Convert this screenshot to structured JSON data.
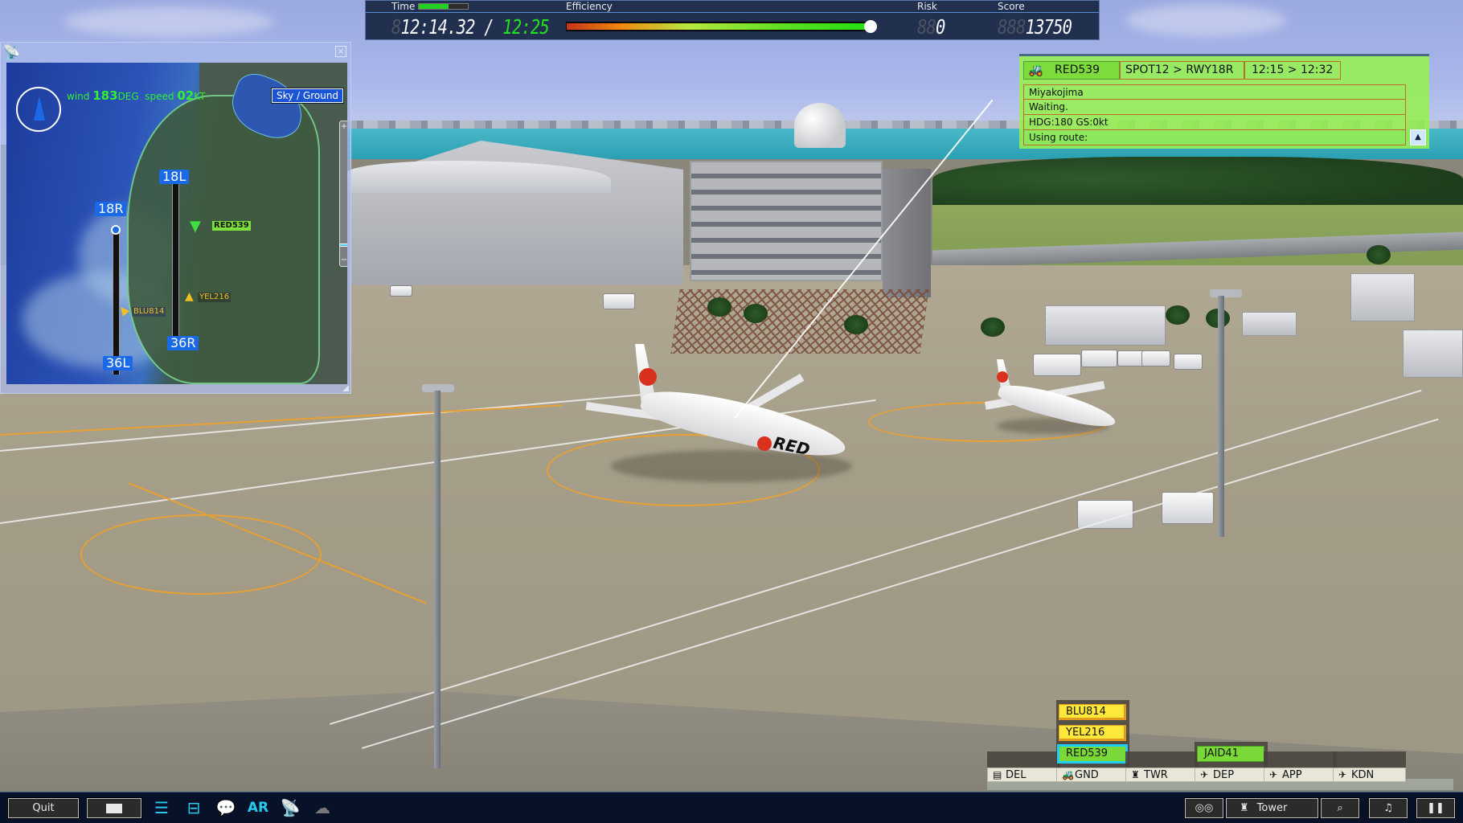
{
  "hud": {
    "time_label": "Time",
    "time_progress": 0.6,
    "efficiency_label": "Efficiency",
    "efficiency_value": 1.0,
    "risk_label": "Risk",
    "score_label": "Score",
    "clock_ghost": "8",
    "clock_current": "12:14.32",
    "clock_sep": "/",
    "clock_end": "12:25",
    "risk_ghost": "88",
    "risk_value": "0",
    "score_ghost": "888",
    "score_value": "13750"
  },
  "minimap": {
    "close_icon": "close-icon",
    "wind_prefix": "wind",
    "wind_deg": "183",
    "wind_deg_unit": "DEG",
    "speed_prefix": "speed",
    "wind_speed": "02",
    "wind_speed_unit": "KT",
    "view_toggle": "Sky / Ground",
    "zoom_plus": "+",
    "zoom_minus": "−",
    "runways": [
      {
        "label": "18L"
      },
      {
        "label": "18R"
      },
      {
        "label": "36R"
      },
      {
        "label": "36L"
      }
    ],
    "aircraft": [
      {
        "callsign": "RED539",
        "color": "#7ce03c"
      },
      {
        "callsign": "YEL216",
        "color": "#f0c020"
      },
      {
        "callsign": "BLU814",
        "color": "#f0c020"
      }
    ]
  },
  "info_panel": {
    "callsign": "RED539",
    "route": "SPOT12 > RWY18R",
    "times": "12:15 > 12:32",
    "lines": [
      "Miyakojima",
      "Waiting.",
      "HDG:180 GS:0kt",
      "Using route:"
    ],
    "scroll_icon": "▲"
  },
  "bays": [
    {
      "label": "DEL",
      "icon": "▤",
      "strips": []
    },
    {
      "label": "GND",
      "icon": "🚜",
      "strips": [
        {
          "callsign": "BLU814",
          "color": "yellow"
        },
        {
          "callsign": "YEL216",
          "color": "yellow"
        },
        {
          "callsign": "RED539",
          "color": "green",
          "selected": true
        }
      ]
    },
    {
      "label": "TWR",
      "icon": "♜",
      "strips": []
    },
    {
      "label": "DEP",
      "icon": "✈",
      "strips": [
        {
          "callsign": "JAID41",
          "color": "green"
        }
      ]
    },
    {
      "label": "APP",
      "icon": "✈",
      "strips": []
    },
    {
      "label": "KDN",
      "icon": "✈",
      "strips": []
    }
  ],
  "toolbar": {
    "quit_label": "Quit",
    "ar_label": "AR",
    "tower_label": "Tower",
    "pause_label": "❚❚",
    "music_label": "♫",
    "search_label": "⌕",
    "binoculars_label": "◎◎"
  },
  "scene": {
    "airline_livery": "RED"
  }
}
